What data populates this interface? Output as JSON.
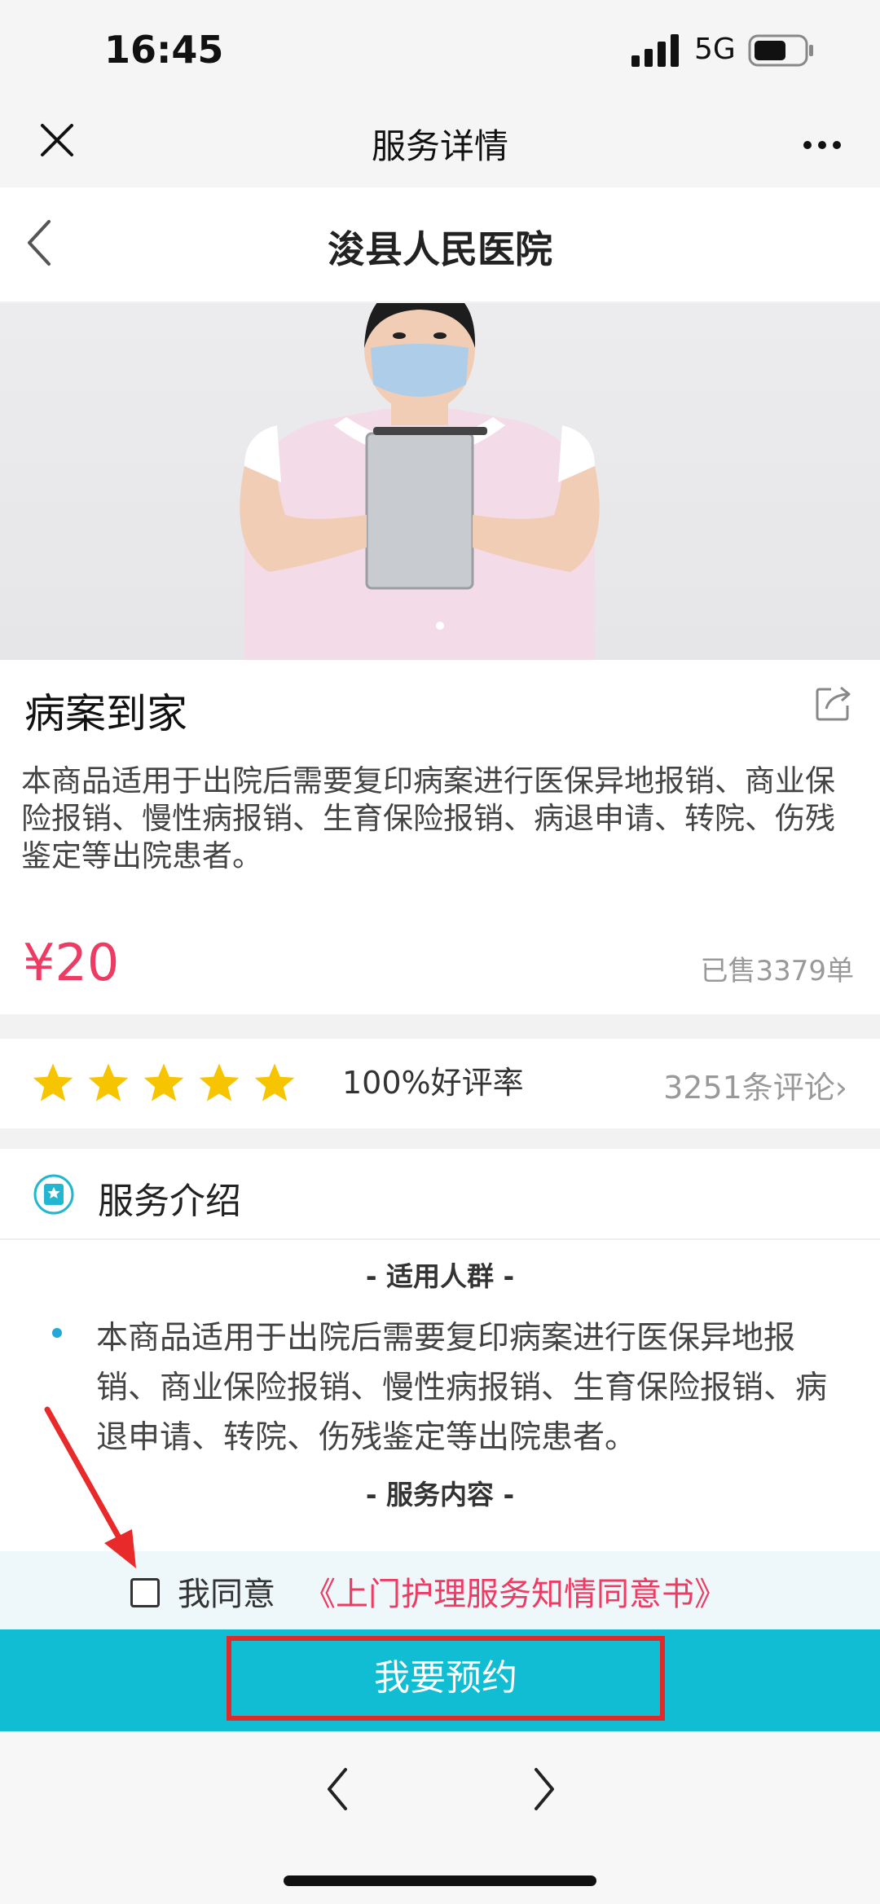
{
  "status_bar": {
    "time": "16:45",
    "network": "5G"
  },
  "wechat_nav": {
    "title": "服务详情"
  },
  "header": {
    "title": "浚县人民医院"
  },
  "product": {
    "title": "病案到家",
    "description": "本商品适用于出院后需要复印病案进行医保异地报销、商业保险报销、慢性病报销、生育保险报销、病退申请、转院、伤残鉴定等出院患者。",
    "price": "¥20",
    "sold": "已售3379单"
  },
  "rating": {
    "stars": 5,
    "good_rate": "100%好评率",
    "comments": "3251条评论›"
  },
  "service_intro": {
    "title": "服务介绍",
    "section1": "- 适用人群 -",
    "section1_text": "本商品适用于出院后需要复印病案进行医保异地报销、商业保险报销、慢性病报销、生育保险报销、病退申请、转院、伤残鉴定等出院患者。",
    "section2": "- 服务内容 -"
  },
  "agreement": {
    "checked": false,
    "label": "我同意",
    "link": "《上门护理服务知情同意书》"
  },
  "book_button": {
    "label": "我要预约"
  },
  "colors": {
    "accent": "#11bdd2",
    "price": "#ee3b63",
    "star": "#f7c400",
    "highlight_box": "#e02a2a"
  }
}
